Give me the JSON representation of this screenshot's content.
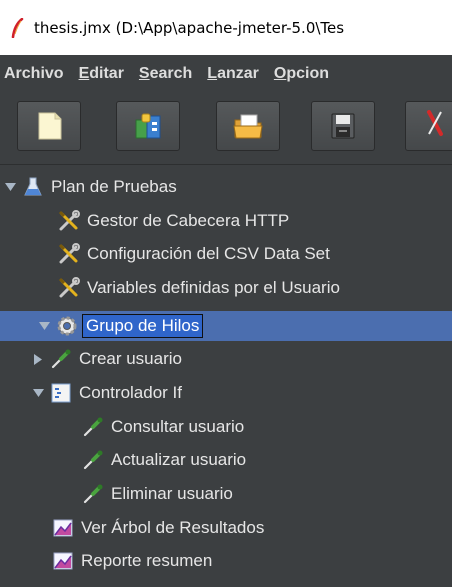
{
  "window": {
    "title": "thesis.jmx (D:\\App\\apache-jmeter-5.0\\Tes"
  },
  "menu": [
    {
      "label": "Archivo",
      "mnemonic_index": -1
    },
    {
      "label": "Editar",
      "mnemonic_index": 0
    },
    {
      "label": "Search",
      "mnemonic_index": 0
    },
    {
      "label": "Lanzar",
      "mnemonic_index": 0
    },
    {
      "label": "Opcion",
      "mnemonic_index": 0
    }
  ],
  "toolbar": {
    "buttons": [
      {
        "icon": "new-file-icon"
      },
      {
        "icon": "templates-icon"
      },
      {
        "icon": "open-folder-icon"
      },
      {
        "icon": "save-icon"
      },
      {
        "icon": "cut-icon"
      }
    ]
  },
  "tree": {
    "items": [
      {
        "label": "Plan de Pruebas",
        "icon": "test-plan-flask-icon",
        "level": 0,
        "expander": "expanded"
      },
      {
        "label": "Gestor de Cabecera HTTP",
        "icon": "config-wrench-icon",
        "level": 1,
        "expander": "none"
      },
      {
        "label": "Configuración del CSV Data Set",
        "icon": "config-wrench-icon",
        "level": 1,
        "expander": "none"
      },
      {
        "label": "Variables definidas por el Usuario",
        "icon": "config-wrench-icon",
        "level": 1,
        "expander": "none"
      },
      {
        "label": "Grupo de Hilos",
        "icon": "thread-group-gear-icon",
        "level": 1,
        "expander": "expanded",
        "selected": true
      },
      {
        "label": "Crear usuario",
        "icon": "sampler-pipette-icon",
        "level": 2,
        "expander": "collapsed"
      },
      {
        "label": "Controlador If",
        "icon": "controller-icon",
        "level": 2,
        "expander": "expanded"
      },
      {
        "label": "Consultar usuario",
        "icon": "sampler-pipette-icon",
        "level": 3,
        "expander": "none"
      },
      {
        "label": "Actualizar usuario",
        "icon": "sampler-pipette-icon",
        "level": 3,
        "expander": "none"
      },
      {
        "label": "Eliminar usuario",
        "icon": "sampler-pipette-icon",
        "level": 3,
        "expander": "none"
      },
      {
        "label": "Ver Árbol de Resultados",
        "icon": "listener-chart-icon",
        "level": 2,
        "expander": "none"
      },
      {
        "label": "Reporte resumen",
        "icon": "listener-chart-icon",
        "level": 2,
        "expander": "none"
      }
    ]
  },
  "colors": {
    "background": "#3c3f41",
    "selection": "#2f65ca",
    "text": "#e6e6e6"
  }
}
